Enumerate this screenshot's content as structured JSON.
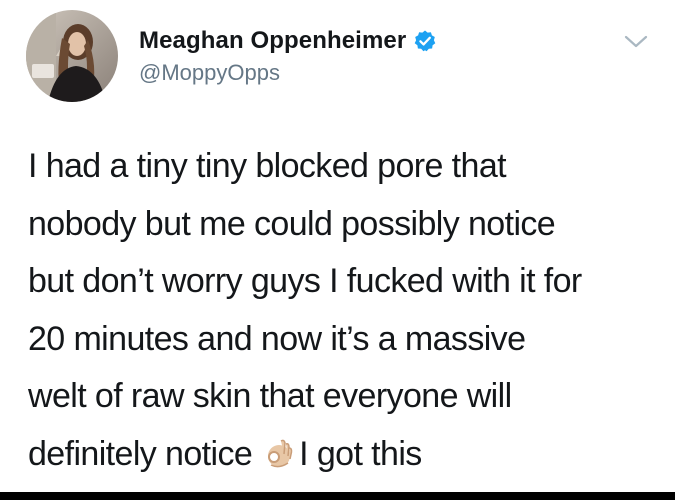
{
  "tweet": {
    "author": {
      "display_name": "Meaghan Oppenheimer",
      "handle": "@MoppyOpps",
      "verified": true,
      "verified_icon": "verified-badge-icon",
      "verified_color": "#1da1f2"
    },
    "menu_icon": "chevron-down-icon",
    "text_lines": [
      "I had a tiny tiny blocked pore that",
      "nobody but me could possibly notice",
      "but don’t worry guys I fucked with it for",
      "20 minutes and now it’s a massive",
      "welt of raw skin that everyone will",
      "definitely notice"
    ],
    "emoji": "ok-hand-icon",
    "text_after_emoji": "I got this"
  }
}
